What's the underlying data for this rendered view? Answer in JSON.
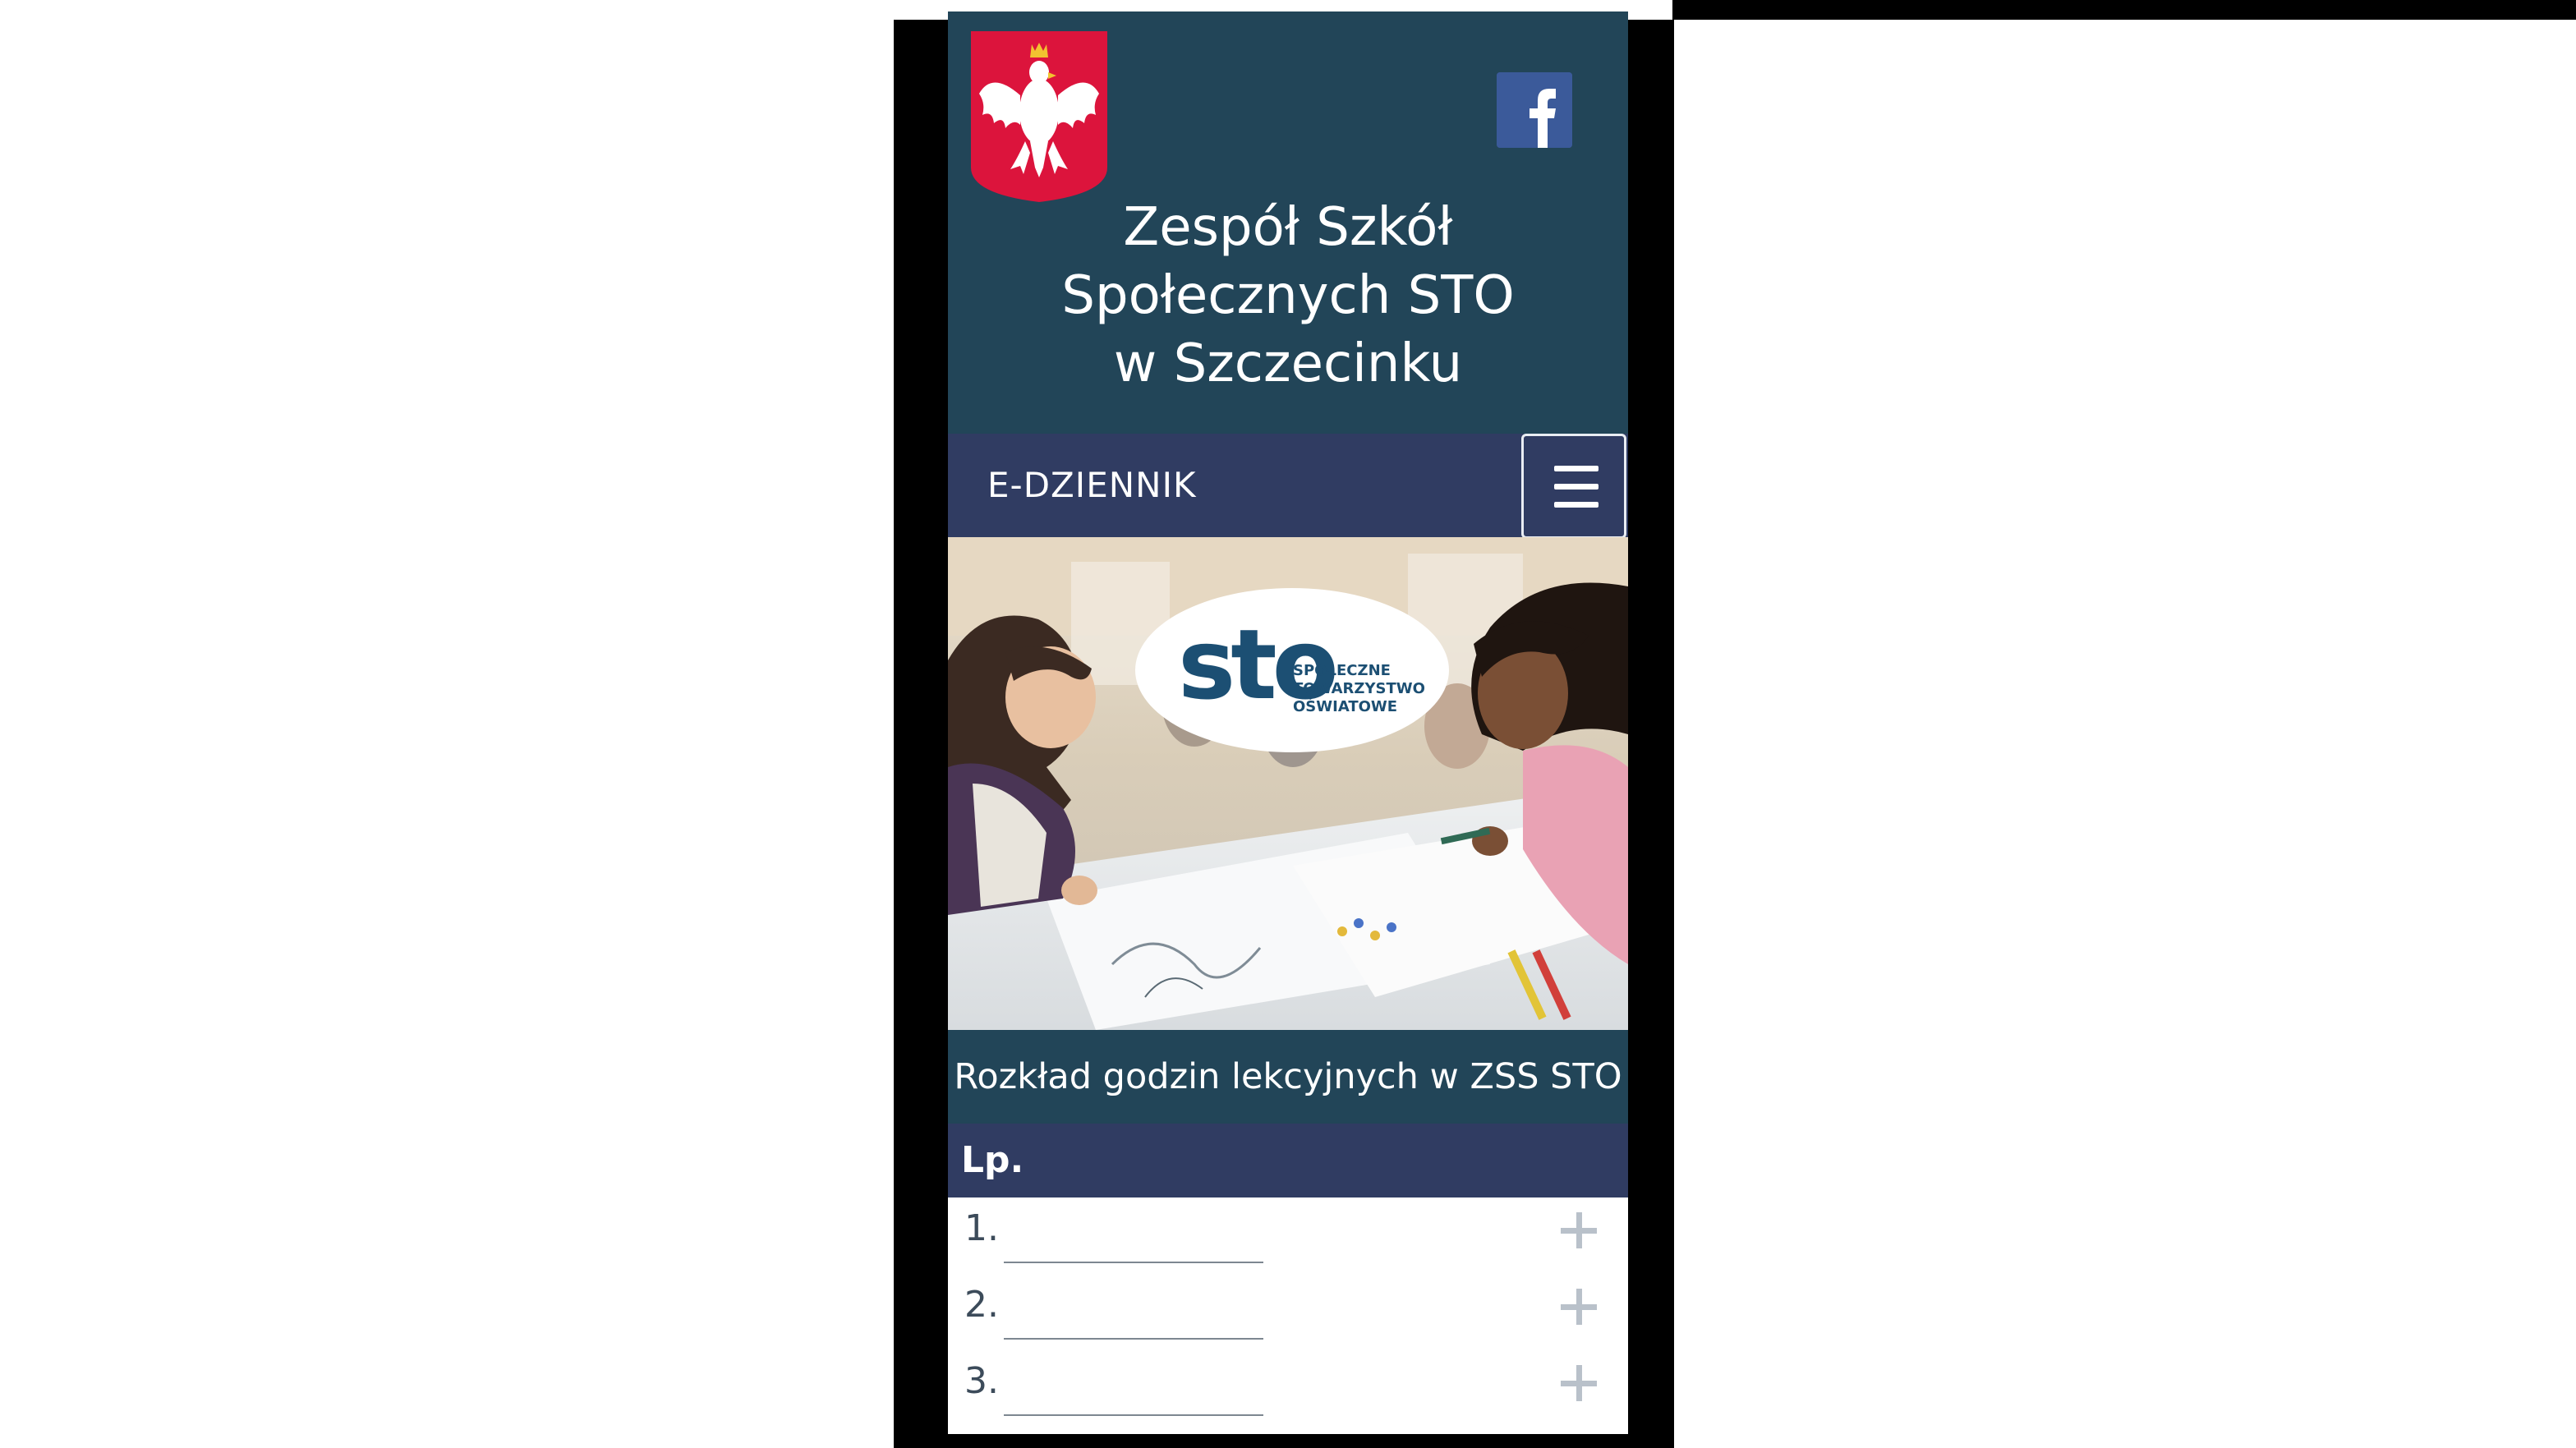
{
  "header": {
    "title_lines": [
      "Zespół Szkół",
      "Społecznych STO",
      "w Szczecinku"
    ],
    "emblem_icon": "polish-eagle-icon",
    "facebook_icon": "facebook-icon"
  },
  "nav": {
    "link_label": "E-DZIENNIK",
    "menu_icon": "hamburger-menu-icon"
  },
  "hero": {
    "logo_letters": "sto",
    "logo_lines": [
      "SPOŁECZNE",
      "TOWARZYSTWO",
      "OŚWIATOWE"
    ]
  },
  "timetable": {
    "title": "Rozkład godzin lekcyjnych w ZSS STO",
    "header": "Lp.",
    "rows": [
      {
        "num": "1.",
        "expand_icon": "plus-icon"
      },
      {
        "num": "2.",
        "expand_icon": "plus-icon"
      },
      {
        "num": "3.",
        "expand_icon": "plus-icon"
      }
    ]
  },
  "colors": {
    "header_bg": "#224558",
    "nav_bg": "#303c62",
    "facebook": "#3b5a9a",
    "emblem_red": "#dc143c"
  }
}
